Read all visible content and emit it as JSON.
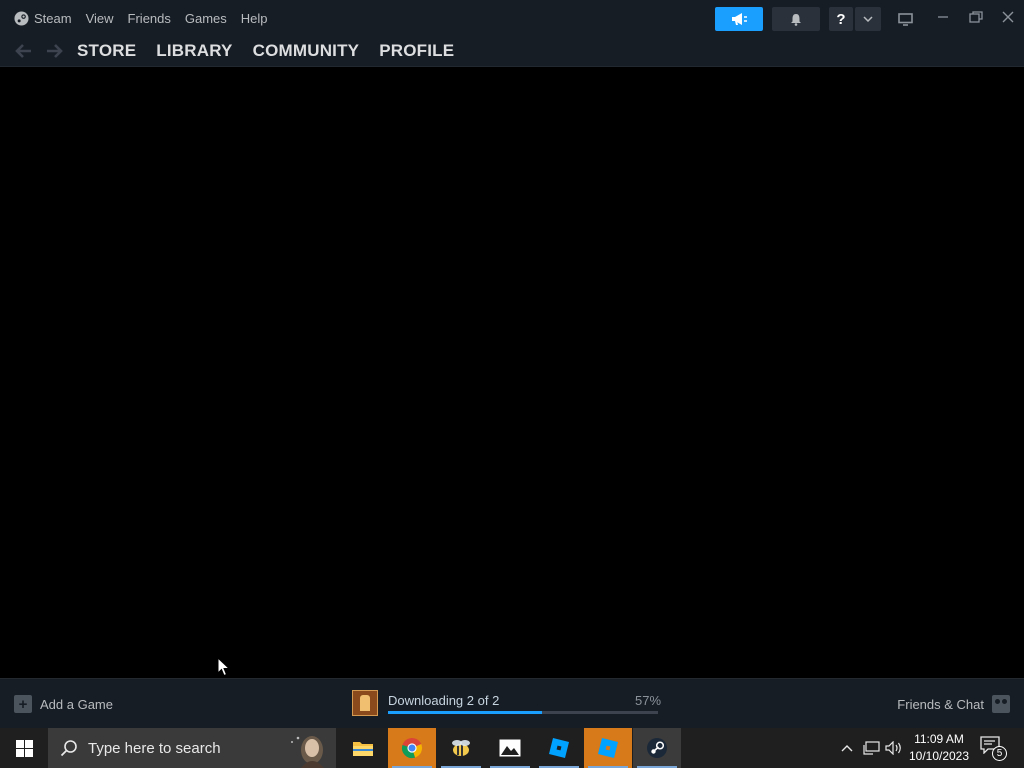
{
  "menu": {
    "app_name": "Steam",
    "items": [
      "View",
      "Friends",
      "Games",
      "Help"
    ]
  },
  "toolbar": {
    "help_label": "?",
    "help_dropdown": "⌄"
  },
  "nav": {
    "links": [
      "STORE",
      "LIBRARY",
      "COMMUNITY",
      "PROFILE"
    ]
  },
  "bottom": {
    "add_game_label": "Add a Game",
    "download_status": "Downloading 2 of 2",
    "download_percent_label": "57%",
    "download_progress": 0.57,
    "friends_label": "Friends & Chat"
  },
  "taskbar": {
    "search_placeholder": "Type here to search",
    "apps": [
      "file-explorer-icon",
      "chrome-icon",
      "bee-app-icon",
      "photos-icon",
      "roblox-studio-icon",
      "roblox-icon",
      "steam-icon"
    ],
    "time": "11:09 AM",
    "date": "10/10/2023",
    "notification_count": "5"
  },
  "colors": {
    "accent": "#1a9fff",
    "titlebar_bg": "#171d25",
    "taskbar_bg": "#1f1f1f"
  }
}
